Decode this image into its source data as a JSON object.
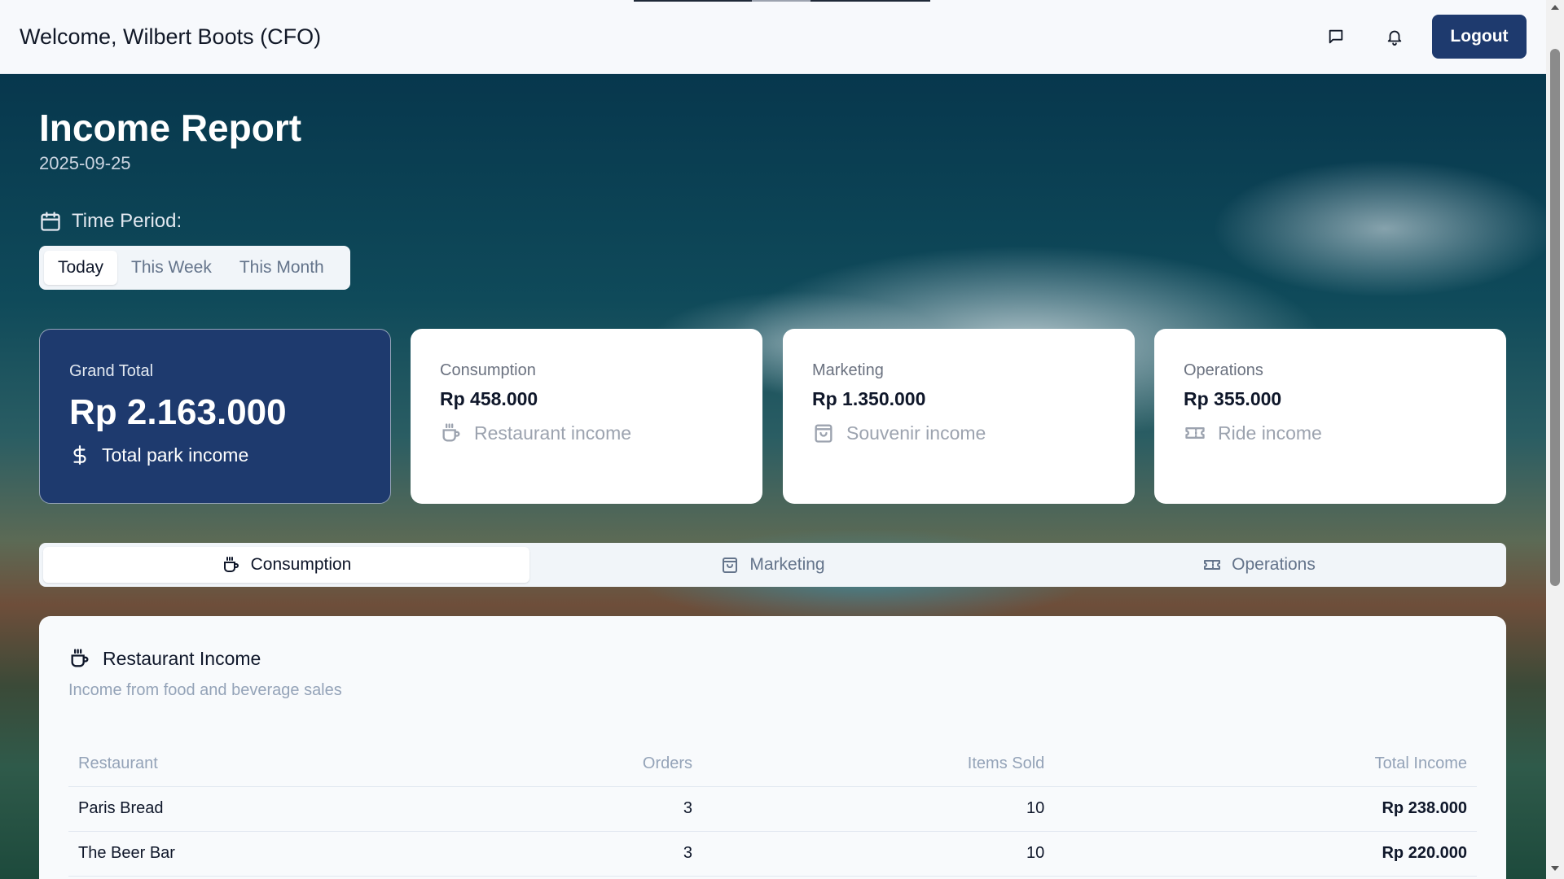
{
  "header": {
    "welcome": "Welcome, Wilbert Boots (CFO)",
    "logout_label": "Logout",
    "icons": [
      "message-icon",
      "bell-icon"
    ]
  },
  "report": {
    "title": "Income Report",
    "date": "2025-09-25",
    "period_label": "Time Period:",
    "periods": [
      "Today",
      "This Week",
      "This Month"
    ],
    "selected_period": "Today"
  },
  "cards": {
    "grand": {
      "label": "Grand Total",
      "value": "Rp 2.163.000",
      "sub": "Total park income",
      "icon": "dollar-icon"
    },
    "consumption": {
      "label": "Consumption",
      "value": "Rp 458.000",
      "sub": "Restaurant income",
      "icon": "coffee-icon"
    },
    "marketing": {
      "label": "Marketing",
      "value": "Rp 1.350.000",
      "sub": "Souvenir income",
      "icon": "shopping-bag-icon"
    },
    "operations": {
      "label": "Operations",
      "value": "Rp 355.000",
      "sub": "Ride income",
      "icon": "ticket-icon"
    }
  },
  "tabs": [
    {
      "label": "Consumption",
      "icon": "coffee-icon",
      "active": true
    },
    {
      "label": "Marketing",
      "icon": "shopping-bag-icon",
      "active": false
    },
    {
      "label": "Operations",
      "icon": "ticket-icon",
      "active": false
    }
  ],
  "panel": {
    "title": "Restaurant Income",
    "description": "Income from food and beverage sales",
    "columns": [
      "Restaurant",
      "Orders",
      "Items Sold",
      "Total Income"
    ],
    "rows": [
      {
        "name": "Paris Bread",
        "orders": "3",
        "items": "10",
        "income": "Rp 238.000"
      },
      {
        "name": "The Beer Bar",
        "orders": "3",
        "items": "10",
        "income": "Rp 220.000"
      }
    ]
  },
  "colors": {
    "primary": "#1e3a6e",
    "header_bg": "#f7f9fc",
    "muted_text": "#94a3b8"
  }
}
